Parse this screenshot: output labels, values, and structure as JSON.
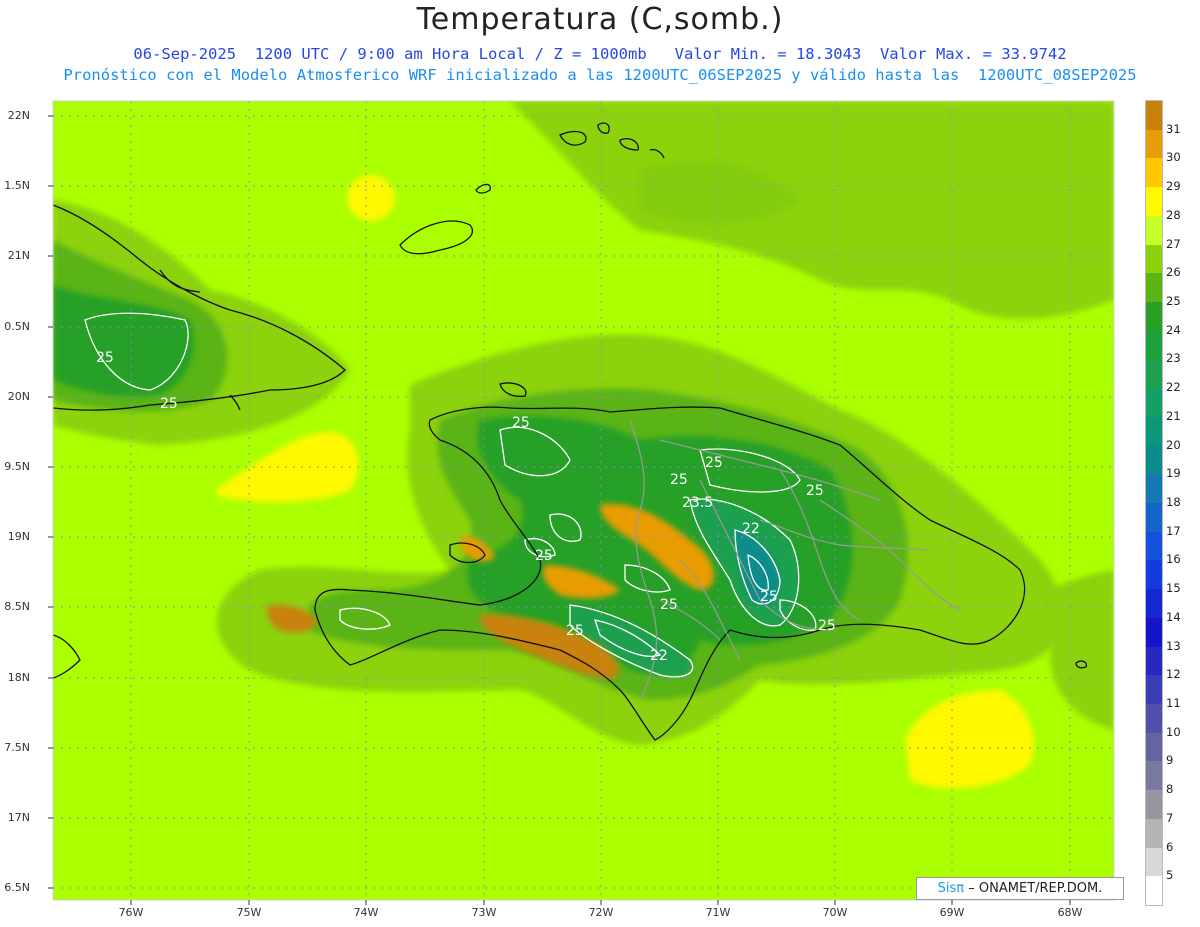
{
  "title": "Temperatura (C,somb.)",
  "subtitle_line1": "06-Sep-2025  1200 UTC / 9:00 am Hora Local / Z = 1000mb   Valor Min. = 18.3043  Valor Max. = 33.9742",
  "subtitle_line2": "Pronóstico con el Modelo Atmosferico WRF inicializado a las 1200UTC_06SEP2025 y válido hasta las  1200UTC_08SEP2025",
  "lat_labels": [
    "22N",
    "1.5N",
    "21N",
    "0.5N",
    "20N",
    "9.5N",
    "19N",
    "8.5N",
    "18N",
    "7.5N",
    "17N",
    "6.5N"
  ],
  "lon_labels": [
    "76W",
    "75W",
    "74W",
    "73W",
    "72W",
    "71W",
    "70W",
    "69W",
    "68W"
  ],
  "colorbar": {
    "labels": [
      "31",
      "30",
      "29",
      "28",
      "27",
      "26",
      "25",
      "24",
      "23",
      "22",
      "21",
      "20",
      "19",
      "18",
      "17",
      "16",
      "15",
      "14",
      "13",
      "12",
      "11",
      "10",
      "9",
      "8",
      "7",
      "6",
      "5"
    ],
    "colors": [
      "#c8820a",
      "#e89c06",
      "#ffc800",
      "#fff800",
      "#c8ff28",
      "#8cd20a",
      "#5ab414",
      "#28a028",
      "#1ea03c",
      "#1ea050",
      "#14a064",
      "#0a9678",
      "#0a8c8c",
      "#1478b4",
      "#1464c8",
      "#1450dc",
      "#143cdc",
      "#1428d2",
      "#1414c8",
      "#2828be",
      "#3c3cb4",
      "#5050aa",
      "#6464a0",
      "#7878a0",
      "#9696a0",
      "#b4b4b4",
      "#d8d8d8",
      "#ffffff"
    ]
  },
  "contour_labels": [
    "25",
    "25",
    "25",
    "25",
    "25",
    "25",
    "25",
    "23.5",
    "22",
    "25",
    "25",
    "25",
    "22",
    "25"
  ],
  "credit": {
    "brand": "Sisπ",
    "org": "– ONAMET/REP.DOM."
  },
  "colors": {
    "base": "#aaff00",
    "green_light": "#8cd20a",
    "green_mid": "#5ab414",
    "green_dark": "#28a028",
    "blue_green": "#0a8c8c",
    "yellow": "#fff800",
    "orange": "#e89c06",
    "brown": "#c8820a"
  }
}
